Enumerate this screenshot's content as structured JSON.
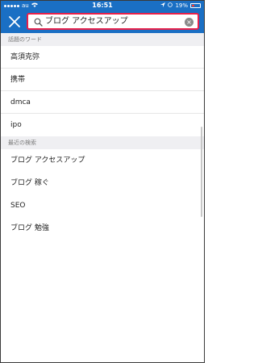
{
  "status_bar": {
    "carrier": "au",
    "time": "16:51",
    "battery": "19%"
  },
  "header": {
    "search_value": "ブログ アクセスアップ",
    "clear_glyph": "×"
  },
  "trending": {
    "title": "話題のワード",
    "items": [
      "高須克弥",
      "携帯",
      "dmca",
      "ipo"
    ]
  },
  "recent": {
    "title": "最近の検索",
    "items": [
      "ブログ アクセスアップ",
      "ブログ 稼ぐ",
      "SEO",
      "ブログ 勉強"
    ]
  },
  "colors": {
    "header_blue": "#1a6fc4",
    "search_border": "#e8204a",
    "section_bg": "#efeff2"
  }
}
